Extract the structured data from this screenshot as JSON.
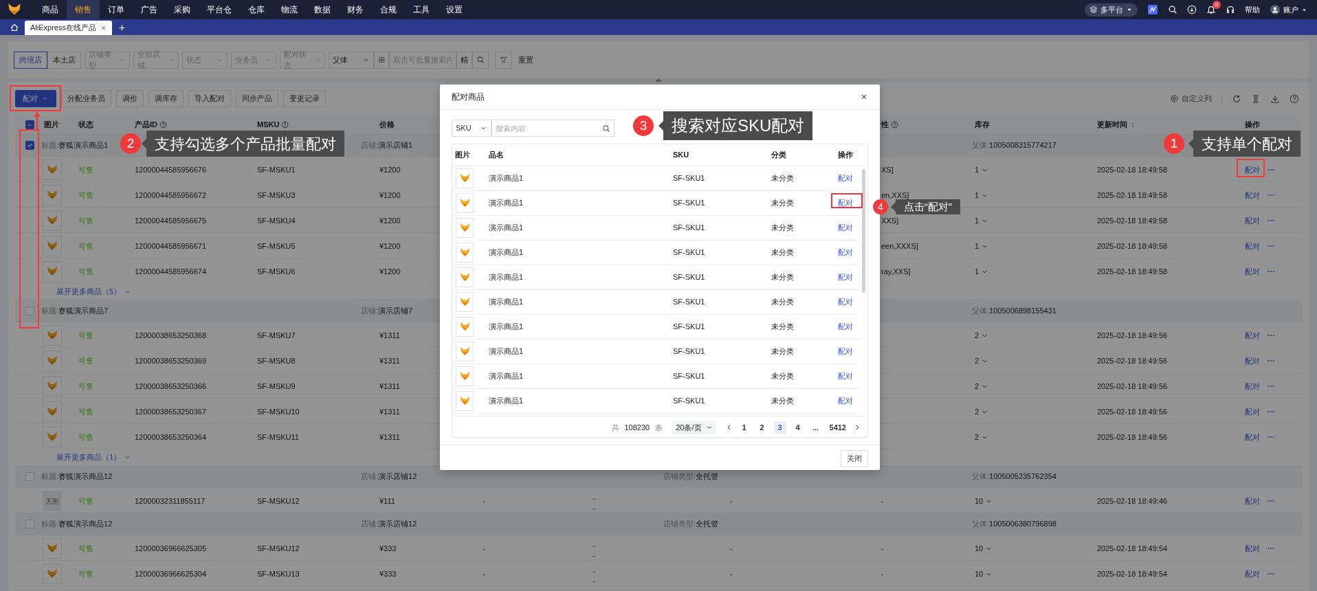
{
  "top_nav": {
    "items": [
      {
        "label": "商品",
        "selected": false
      },
      {
        "label": "销售",
        "selected": true
      },
      {
        "label": "订单",
        "selected": false
      },
      {
        "label": "广告",
        "selected": false
      },
      {
        "label": "采购",
        "selected": false
      },
      {
        "label": "平台仓",
        "selected": false
      },
      {
        "label": "仓库",
        "selected": false
      },
      {
        "label": "物流",
        "selected": false
      },
      {
        "label": "数据",
        "selected": false
      },
      {
        "label": "财务",
        "selected": false
      },
      {
        "label": "合规",
        "selected": false
      },
      {
        "label": "工具",
        "selected": false
      },
      {
        "label": "设置",
        "selected": false
      }
    ],
    "platform": "多平台",
    "notification_count": "8",
    "help": "帮助",
    "account": "账户"
  },
  "tabs": [
    {
      "label": "AliExpress在线产品",
      "selected": true
    }
  ],
  "filters": {
    "scope": [
      {
        "label": "跨境店",
        "selected": true
      },
      {
        "label": "本土店",
        "selected": false
      }
    ],
    "selects": [
      {
        "placeholder": "店铺类型"
      },
      {
        "placeholder": "全部店铺"
      },
      {
        "placeholder": "状态"
      },
      {
        "placeholder": "业务员"
      },
      {
        "placeholder": "配对状态"
      }
    ],
    "search_field": "父体",
    "search": {
      "placeholder": "双击可批量搜索内"
    },
    "exact_toggle": "精",
    "reset": "重置"
  },
  "toolbar": {
    "buttons": [
      {
        "label": "配对",
        "kind": "primary"
      },
      {
        "label": "分配业务员",
        "kind": "default"
      },
      {
        "label": "调价",
        "kind": "default"
      },
      {
        "label": "调库存",
        "kind": "default"
      },
      {
        "label": "导入配对",
        "kind": "default"
      },
      {
        "label": "同步产品",
        "kind": "default"
      },
      {
        "label": "变更记录",
        "kind": "default"
      }
    ],
    "custom_columns": "自定义列"
  },
  "table": {
    "select_all": {
      "checked": false,
      "indeterminate": true
    },
    "columns": [
      {
        "label": "图片"
      },
      {
        "label": "状态"
      },
      {
        "label": "产品ID",
        "help": true
      },
      {
        "label": "MSKU",
        "help": true
      },
      {
        "label": "价格"
      },
      {
        "label": "性",
        "help": true
      },
      {
        "label": "库存"
      },
      {
        "label": "更新时间",
        "sortable": true
      },
      {
        "label": "操作"
      }
    ],
    "groups": [
      {
        "checked": true,
        "title_label": "标题:",
        "title": "赛狐演示商品1",
        "shop_label": "店铺:",
        "shop": "演示店铺1",
        "parent_label": "父体:",
        "parent": "1005008315774217",
        "expand": "展开更多商品（5）",
        "items": [
          {
            "kind": "thumbnail",
            "status": "可售",
            "product_id": "12000044585956676",
            "msku": "SF-MSKU1",
            "price": "¥1200",
            "attribute": "XS]",
            "stock": "1",
            "updated": "2025-02-18 18:49:58",
            "action": "配对"
          },
          {
            "kind": "thumbnail",
            "status": "可售",
            "product_id": "12000044585956672",
            "msku": "SF-MSKU3",
            "price": "¥1200",
            "attribute": "en,XXS]",
            "stock": "1",
            "updated": "2025-02-18 18:49:58",
            "action": "配对"
          },
          {
            "kind": "thumbnail",
            "status": "可售",
            "product_id": "12000044585956675",
            "msku": "SF-MSKU4",
            "price": "¥1200",
            "attribute": "XXS]",
            "stock": "1",
            "updated": "2025-02-18 18:49:58",
            "action": "配对"
          },
          {
            "kind": "thumbnail",
            "status": "可售",
            "product_id": "12000044585956671",
            "msku": "SF-MSKU5",
            "price": "¥1200",
            "attribute": "een,XXXS]",
            "stock": "1",
            "updated": "2025-02-18 18:49:58",
            "action": "配对"
          },
          {
            "kind": "thumbnail",
            "status": "可售",
            "product_id": "12000044585956674",
            "msku": "SF-MSKU6",
            "price": "¥1200",
            "attribute": "ray,XXS]",
            "stock": "1",
            "updated": "2025-02-18 18:49:58",
            "action": "配对"
          }
        ]
      },
      {
        "checked": false,
        "title_label": "标题:",
        "title": "赛狐演示商品7",
        "shop_label": "店铺:",
        "shop": "演示店铺7",
        "parent_label": "父体:",
        "parent": "1005006898155431",
        "expand": "展开更多商品（1）",
        "items": [
          {
            "kind": "thumbnail",
            "status": "可售",
            "product_id": "12000038653250368",
            "msku": "SF-MSKU7",
            "price": "¥1311",
            "stock": "2",
            "updated": "2025-02-18 18:49:56",
            "action": "配对"
          },
          {
            "kind": "thumbnail",
            "status": "可售",
            "product_id": "12000038653250369",
            "msku": "SF-MSKU8",
            "price": "¥1311",
            "stock": "2",
            "updated": "2025-02-18 18:49:56",
            "action": "配对"
          },
          {
            "kind": "thumbnail",
            "status": "可售",
            "product_id": "12000038653250366",
            "msku": "SF-MSKU9",
            "price": "¥1311",
            "stock": "2",
            "updated": "2025-02-18 18:49:56",
            "action": "配对"
          },
          {
            "kind": "thumbnail",
            "status": "可售",
            "product_id": "12000038653250367",
            "msku": "SF-MSKU10",
            "price": "¥1311",
            "stock": "2",
            "updated": "2025-02-18 18:49:56",
            "action": "配对"
          },
          {
            "kind": "thumbnail",
            "status": "可售",
            "product_id": "12000038653250364",
            "msku": "SF-MSKU11",
            "price": "¥1311",
            "stock": "2",
            "updated": "2025-02-18 18:49:56",
            "action": "配对"
          }
        ]
      },
      {
        "checked": false,
        "title_label": "标题:",
        "title": "赛狐演示商品12",
        "shop_label": "店铺:",
        "shop": "演示店铺12",
        "shop_type_label": "店铺类型:",
        "shop_type": "全托管",
        "parent_label": "父体:",
        "parent": "1005005235762354",
        "items": [
          {
            "kind": "no_image",
            "image_text": "无图",
            "status": "可售",
            "product_id": "12000032311855117",
            "msku": "SF-MSKU12",
            "price": "¥111",
            "column_7": "-",
            "column_8": [
              "-",
              "-"
            ],
            "column_9": "-",
            "attribute": "-",
            "stock": "10",
            "updated": "2025-02-18 18:49:46",
            "action": "配对"
          }
        ]
      },
      {
        "checked": false,
        "title_label": "标题:",
        "title": "赛狐演示商品12",
        "shop_label": "店铺:",
        "shop": "演示店铺12",
        "shop_type_label": "店铺类型:",
        "shop_type": "全托管",
        "parent_label": "父体:",
        "parent": "1005006380796898",
        "items": [
          {
            "kind": "thumbnail",
            "status": "可售",
            "product_id": "12000036966625305",
            "msku": "SF-MSKU12",
            "price": "¥333",
            "column_7": "-",
            "column_8": [
              "-",
              "-"
            ],
            "column_9": "-",
            "attribute": "-",
            "stock": "10",
            "updated": "2025-02-18 18:49:54",
            "action": "配对"
          },
          {
            "kind": "thumbnail",
            "status": "可售",
            "product_id": "12000036966625304",
            "msku": "SF-MSKU13",
            "price": "¥333",
            "column_7": "-",
            "column_8": [
              "-",
              "-"
            ],
            "column_9": "-",
            "attribute": "-",
            "stock": "10",
            "updated": "2025-02-18 18:49:54",
            "action": "配对"
          }
        ]
      }
    ]
  },
  "modal": {
    "title": "配对商品",
    "search_field": "SKU",
    "search": {
      "placeholder": "搜索内容"
    },
    "columns": [
      "图片",
      "品名",
      "SKU",
      "分类",
      "操作"
    ],
    "rows": [
      {
        "name": "演示商品1",
        "sku": "SF-SKU1",
        "category": "未分类",
        "action": "配对"
      },
      {
        "name": "演示商品1",
        "sku": "SF-SKU1",
        "category": "未分类",
        "action": "配对"
      },
      {
        "name": "演示商品1",
        "sku": "SF-SKU1",
        "category": "未分类",
        "action": "配对"
      },
      {
        "name": "演示商品1",
        "sku": "SF-SKU1",
        "category": "未分类",
        "action": "配对"
      },
      {
        "name": "演示商品1",
        "sku": "SF-SKU1",
        "category": "未分类",
        "action": "配对"
      },
      {
        "name": "演示商品1",
        "sku": "SF-SKU1",
        "category": "未分类",
        "action": "配对"
      },
      {
        "name": "演示商品1",
        "sku": "SF-SKU1",
        "category": "未分类",
        "action": "配对"
      },
      {
        "name": "演示商品1",
        "sku": "SF-SKU1",
        "category": "未分类",
        "action": "配对"
      },
      {
        "name": "演示商品1",
        "sku": "SF-SKU1",
        "category": "未分类",
        "action": "配对"
      },
      {
        "name": "演示商品1",
        "sku": "SF-SKU1",
        "category": "未分类",
        "action": "配对"
      }
    ],
    "pagination": {
      "total_prefix": "共",
      "total": "108230",
      "total_suffix": "条",
      "page_size": "20条/页",
      "pages": [
        {
          "label": "1",
          "selected": false
        },
        {
          "label": "2",
          "selected": false
        },
        {
          "label": "3",
          "selected": true
        },
        {
          "label": "4",
          "selected": false
        },
        {
          "label": "...",
          "selected": false
        },
        {
          "label": "5412",
          "selected": false
        }
      ]
    },
    "close": "关闭"
  },
  "annotations": [
    {
      "number": "3",
      "text": "搜索对应SKU配对"
    },
    {
      "number": "2",
      "text": "支持勾选多个产品批量配对"
    },
    {
      "number": "1",
      "text": "支持单个配对"
    },
    {
      "number": "4",
      "text": "点击“配对”"
    }
  ]
}
